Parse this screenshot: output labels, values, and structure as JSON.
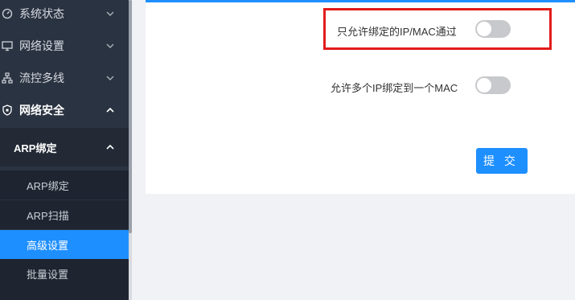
{
  "sidebar": {
    "items": [
      {
        "label": "系统状态",
        "icon": "gauge-icon"
      },
      {
        "label": "网络设置",
        "icon": "monitor-icon"
      },
      {
        "label": "流控多线",
        "icon": "network-icon"
      },
      {
        "label": "网络安全",
        "icon": "shield-icon"
      }
    ],
    "subgroup": {
      "label": "ARP绑定"
    },
    "subitems": [
      {
        "label": "ARP绑定"
      },
      {
        "label": "ARP扫描"
      },
      {
        "label": "高级设置",
        "active": true
      },
      {
        "label": "批量设置"
      }
    ]
  },
  "settings": {
    "only_bound": {
      "label": "只允许绑定的IP/MAC通过",
      "enabled": false
    },
    "multi_ip": {
      "label": "允许多个IP绑定到一个MAC",
      "enabled": false
    },
    "submit_label": "提 交"
  },
  "colors": {
    "sidebar_bg": "#2a3341",
    "accent": "#1e8fff",
    "highlight": "#e21b1b"
  }
}
